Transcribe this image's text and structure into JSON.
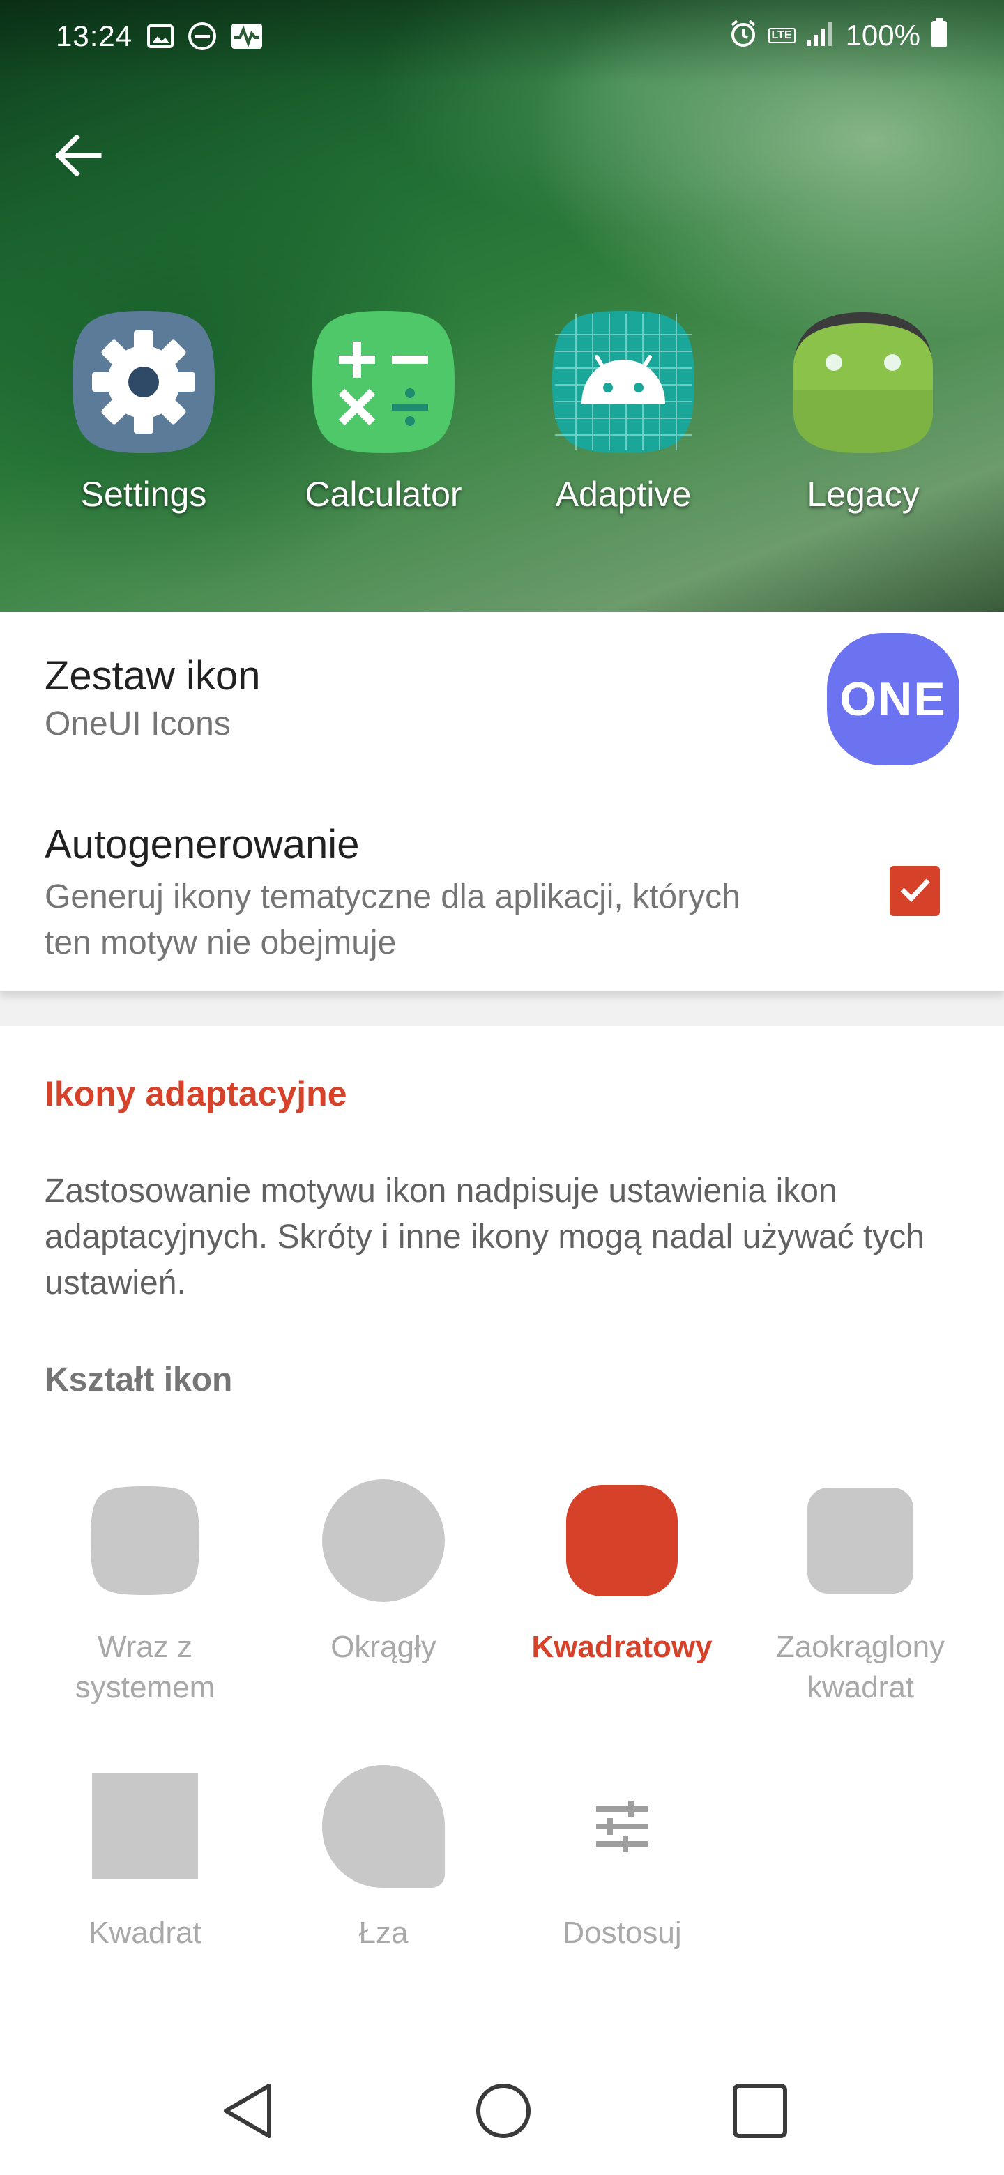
{
  "status_bar": {
    "time": "13:24",
    "battery": "100%",
    "network_badge": "LTE",
    "icons_left": [
      "image-icon",
      "do-not-disturb-icon",
      "activity-icon"
    ],
    "icons_right": [
      "alarm-icon",
      "lte-icon",
      "signal-icon",
      "battery-icon"
    ]
  },
  "header": {
    "back_icon": "arrow-left-icon",
    "preview_icons": [
      {
        "label": "Settings",
        "icon": "gear-icon",
        "color": "#5b7b98"
      },
      {
        "label": "Calculator",
        "icon": "calculator-icon",
        "color": "#4fc86a"
      },
      {
        "label": "Adaptive",
        "icon": "android-grid-icon",
        "color": "#1aa79a"
      },
      {
        "label": "Legacy",
        "icon": "android-legacy-icon",
        "color": "#8bc34a"
      }
    ]
  },
  "settings": {
    "icon_pack": {
      "title": "Zestaw ikon",
      "value": "OneUI Icons",
      "badge_text": "ONE",
      "badge_color": "#6b73f0"
    },
    "autogen": {
      "title": "Autogenerowanie",
      "description": "Generuj ikony tematyczne dla aplikacji, których ten motyw nie obejmuje",
      "checked": true
    }
  },
  "adaptive": {
    "header": "Ikony adaptacyjne",
    "description": "Zastosowanie motywu ikon nadpisuje ustawienia ikon adaptacyjnych. Skróty i inne ikony mogą nadal używać tych ustawień.",
    "shape_title": "Kształt ikon",
    "shapes": [
      {
        "label": "Wraz z systemem",
        "shape": "squircle",
        "selected": false
      },
      {
        "label": "Okrągły",
        "shape": "circle",
        "selected": false
      },
      {
        "label": "Kwadratowy",
        "shape": "rounded-square",
        "selected": true
      },
      {
        "label": "Zaokrąglony kwadrat",
        "shape": "rounded-square-small",
        "selected": false
      },
      {
        "label": "Kwadrat",
        "shape": "square",
        "selected": false
      },
      {
        "label": "Łza",
        "shape": "teardrop",
        "selected": false
      },
      {
        "label": "Dostosuj",
        "shape": "sliders-icon",
        "selected": false
      }
    ]
  },
  "colors": {
    "accent": "#d6412a",
    "inactive_shape": "#c8c8c8"
  },
  "nav_bar": {
    "buttons": [
      "back-triangle-icon",
      "home-circle-icon",
      "recents-square-icon"
    ]
  }
}
